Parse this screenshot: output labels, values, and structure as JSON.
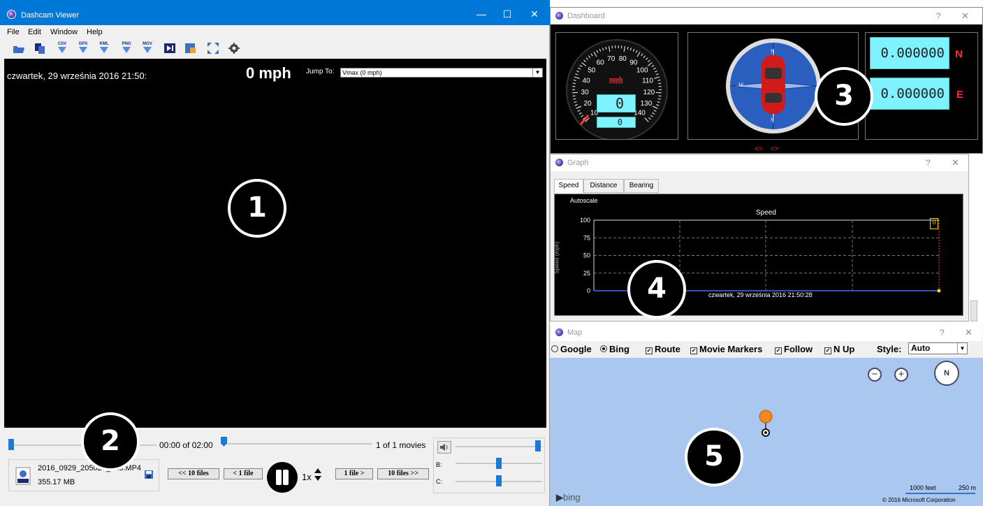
{
  "main_window": {
    "title": "Dashcam Viewer",
    "controls": {
      "minimize": "—",
      "maximize": "☐",
      "close": "✕"
    },
    "menu": [
      "File",
      "Edit",
      "Window",
      "Help"
    ],
    "toolbar": [
      {
        "name": "open-icon",
        "label": ""
      },
      {
        "name": "copy-icon",
        "label": ""
      },
      {
        "name": "export-csv-icon",
        "label": "CSV"
      },
      {
        "name": "export-gpx-icon",
        "label": "GPX"
      },
      {
        "name": "export-kml-icon",
        "label": "KML"
      },
      {
        "name": "export-png-icon",
        "label": "PNG"
      },
      {
        "name": "export-mov-icon",
        "label": "MOV"
      },
      {
        "name": "frame-icon",
        "label": ""
      },
      {
        "name": "lock-icon",
        "label": ""
      },
      {
        "name": "fullscreen-icon",
        "label": ""
      },
      {
        "name": "gear-icon",
        "label": ""
      }
    ]
  },
  "video": {
    "datetime": "czwartek, 29 września 2016 21:50:",
    "speed": "0 mph",
    "jump_to_label": "Jump To:",
    "jump_to_value": "Vmax (0 mph)"
  },
  "badges": [
    "1",
    "2",
    "3",
    "4",
    "5"
  ],
  "playback": {
    "time": "00:00 of 02:00",
    "movie_count": "1 of 1 movies",
    "filename": "2016_0929_205027_013.MP4",
    "filesize": "355.17 MB",
    "btn_prev10": "<< 10 files",
    "btn_prev1": "< 1 file",
    "btn_next1": "1 file >",
    "btn_next10": "10 files >>",
    "rate": "1x",
    "brightness_label": "B:",
    "contrast_label": "C:"
  },
  "dashboard": {
    "title": "Dashboard",
    "help": "?",
    "close": "✕",
    "gauge_unit": "mph",
    "gauge_ticks": [
      "10",
      "20",
      "30",
      "40",
      "50",
      "60",
      "70",
      "80",
      "90",
      "100",
      "110",
      "120",
      "130",
      "140"
    ],
    "speed_digital": "0",
    "odometer": "0",
    "compass_letters": {
      "n": "N",
      "s": "S",
      "e": "E",
      "w": "W"
    },
    "arrows": "<=    =>",
    "lat": "0.000000",
    "lat_hemi": "N",
    "lon": "0.000000",
    "lon_hemi": "E"
  },
  "graph": {
    "title": "Graph",
    "help": "?",
    "close": "✕",
    "tabs": [
      "Speed",
      "Distance",
      "Bearing"
    ],
    "autoscale": "Autoscale",
    "plot_title": "Speed",
    "y_axis_label": "Speed (mph)",
    "y_ticks": [
      "100",
      "75",
      "50",
      "25",
      "0"
    ],
    "footer": "czwartek, 29 września 2016 21:50:28",
    "marker_value": "0"
  },
  "chart_data": {
    "type": "line",
    "title": "Speed",
    "ylabel": "Speed (mph)",
    "ylim": [
      0,
      100
    ],
    "series": [
      {
        "name": "",
        "values": [
          0,
          0
        ]
      }
    ]
  },
  "map": {
    "title": "Map",
    "help": "?",
    "close": "✕",
    "providers": [
      {
        "label": "Google",
        "checked": false
      },
      {
        "label": "Bing",
        "checked": true
      }
    ],
    "options": [
      {
        "label": "Route",
        "checked": true
      },
      {
        "label": "Movie Markers",
        "checked": true
      },
      {
        "label": "Follow",
        "checked": true
      },
      {
        "label": "N Up",
        "checked": true
      }
    ],
    "style_label": "Style:",
    "style_value": "Auto",
    "zoom_out": "−",
    "zoom_in": "+",
    "compass": "N",
    "scale_feet": "1000 feet",
    "scale_m": "250 m",
    "copyright": "© 2016 Microsoft Corporation",
    "brand": "bing"
  },
  "colors": {
    "titlebar": "#0078d7",
    "accent": "#1e78d7",
    "lcd": "#7ef2ff",
    "warning": "#ff2a2a",
    "map_bg": "#a9c7ef"
  }
}
